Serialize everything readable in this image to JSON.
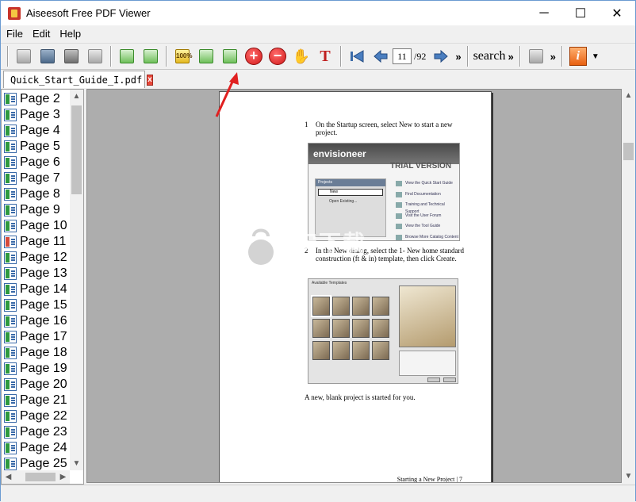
{
  "window": {
    "title": "Aiseesoft Free PDF Viewer",
    "minimize": "─",
    "maximize": "☐",
    "close": "✕"
  },
  "menu": [
    "File",
    "Edit",
    "Help"
  ],
  "toolbar": {
    "zoom_label": "100%",
    "add": "+",
    "remove": "−",
    "text_tool": "T",
    "current_page": "11",
    "total_pages": "/92",
    "more": "»",
    "search_label": "search",
    "info": "i"
  },
  "tab": {
    "filename": "Quick_Start_Guide_I.pdf",
    "close": "x"
  },
  "sidebar": {
    "pages": [
      "Page 2",
      "Page 3",
      "Page 4",
      "Page 5",
      "Page 6",
      "Page 7",
      "Page 8",
      "Page 9",
      "Page 10",
      "Page 11",
      "Page 12",
      "Page 13",
      "Page 14",
      "Page 15",
      "Page 16",
      "Page 17",
      "Page 18",
      "Page 19",
      "Page 20",
      "Page 21",
      "Page 22",
      "Page 23",
      "Page 24",
      "Page 25"
    ],
    "active": "Page 11"
  },
  "pdf": {
    "step1_num": "1",
    "step1_text": "On the Startup screen, select New to start a new project.",
    "shot1_logo": "envisioneer",
    "shot1_trial": "TRIAL VERSION",
    "shot1_panel": "Projects",
    "shot1_new": "New",
    "shot1_open": "Open Existing...",
    "shot1_links": [
      "View the Quick Start Guide",
      "Find Documentation",
      "Training and Technical Support",
      "Visit the User Forum",
      "View the Tool Guide",
      "Browse More Catalog Content"
    ],
    "step2_num": "2",
    "step2_text": "In the New dialog, select the 1- New home standard construction (ft & in) template, then click Create.",
    "shot2_title": "Available Templates",
    "result_text": "A new, blank project is started for you.",
    "footer": "Starting a New Project | 7"
  },
  "watermark": {
    "text": "安下载",
    "sub": "anxz.com"
  },
  "colors": {
    "accent_red": "#d21a1a",
    "annotation": "#e02020",
    "viewer_bg": "#adadad"
  }
}
